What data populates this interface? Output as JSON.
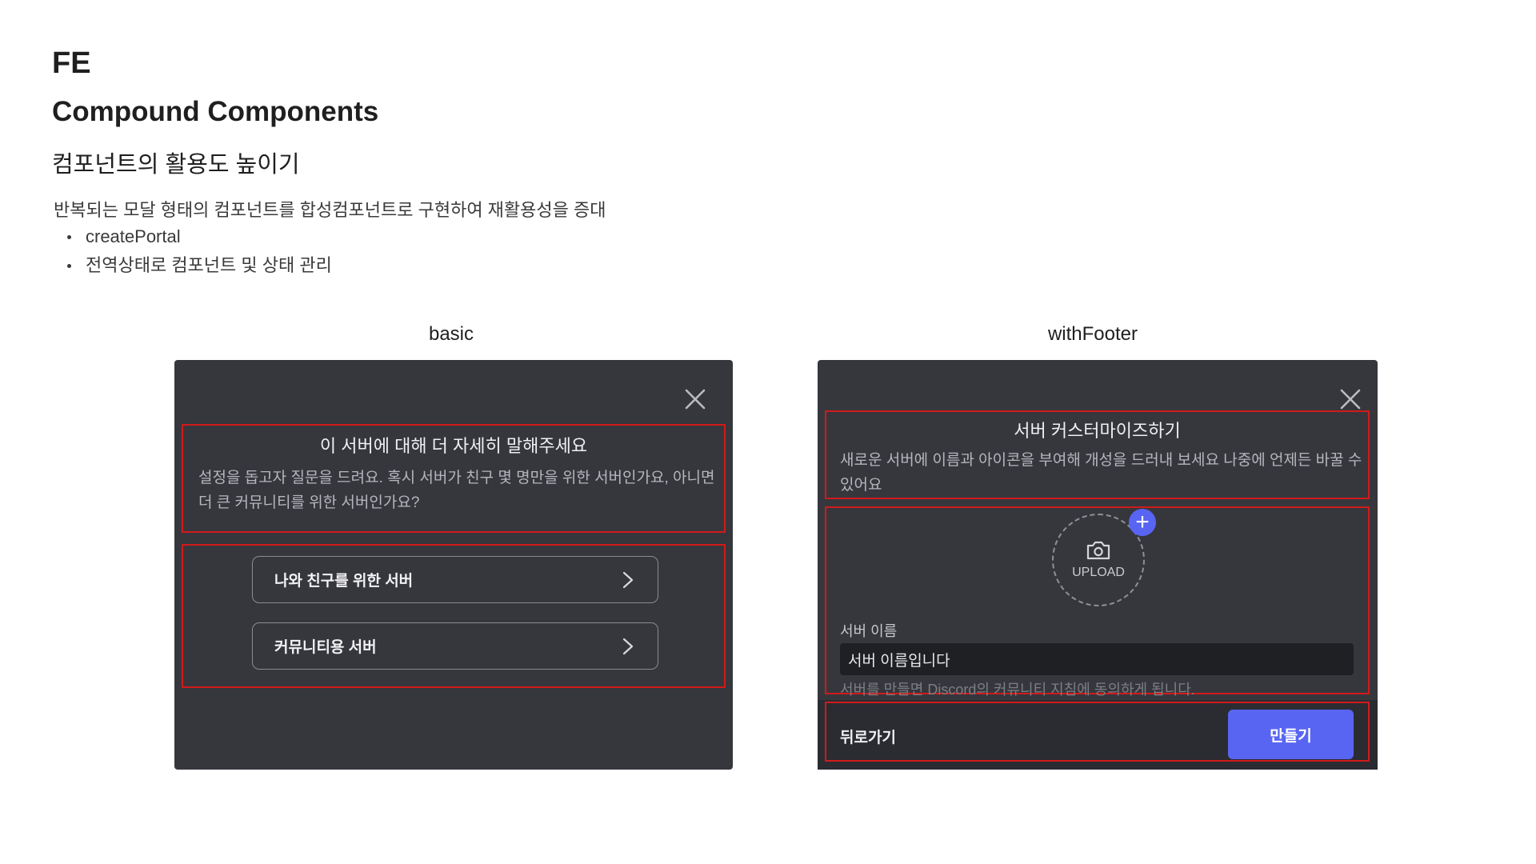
{
  "header": {
    "title": "FE",
    "subtitle": "Compound Components",
    "section": "컴포넌트의 활용도 높이기",
    "description": "반복되는 모달 형태의 컴포넌트를 합성컴포넌트로 구현하여 재활용성을 증대",
    "bullets": [
      "createPortal",
      "전역상태로 컴포넌트 및 상태 관리"
    ]
  },
  "basic": {
    "label": "basic",
    "title": "이 서버에 대해 더 자세히 말해주세요",
    "text_line1": "설정을 돕고자 질문을 드려요. 혹시 서버가 친구 몇 명만을 위한 서버인가요, 아니면",
    "text_line2": "더 큰 커뮤니티를 위한 서버인가요?",
    "options": [
      "나와 친구를 위한 서버",
      "커뮤니티용 서버"
    ],
    "close_icon": "close-icon",
    "chevron_icon": "chevron-right-icon"
  },
  "withFooter": {
    "label": "withFooter",
    "title": "서버 커스터마이즈하기",
    "text_line1": "새로운 서버에 이름과 아이콘을 부여해 개성을 드러내 보세요 나중에 언제든 바꿀 수",
    "text_line2": "있어요",
    "upload_label": "UPLOAD",
    "upload_icon": "camera-icon",
    "plus_icon": "plus-icon",
    "name_label": "서버 이름",
    "name_value": "서버 이름입니다",
    "notice": "서버를 만들면 Discord의 커뮤니티 지침에 동의하게 됩니다.",
    "back_label": "뒤로가기",
    "create_label": "만들기"
  },
  "colors": {
    "modal_bg": "#36373d",
    "highlight": "#d11a1a",
    "primary": "#5865f2"
  }
}
